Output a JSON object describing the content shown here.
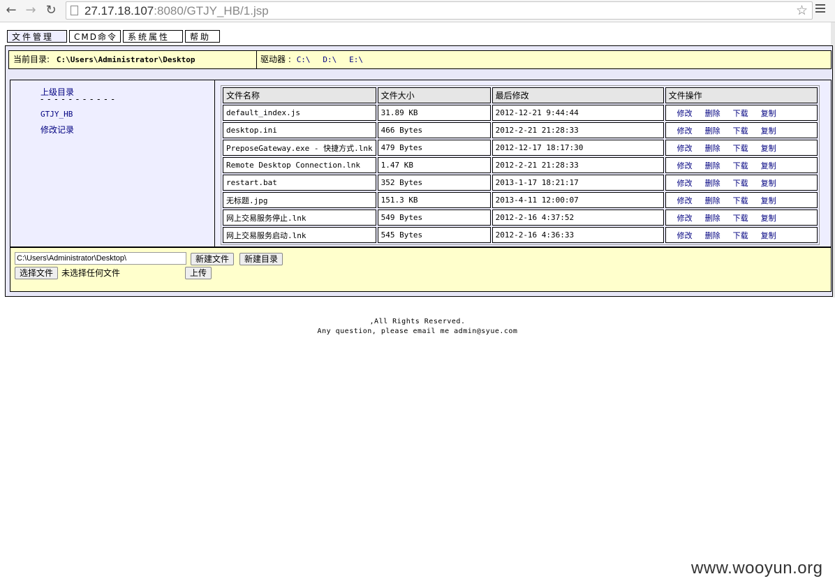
{
  "browser": {
    "url_host": "27.17.18.107",
    "url_rest": ":8080/GTJY_HB/1.jsp"
  },
  "tabs": [
    "文件管理",
    "CMD命令",
    "系统属性",
    "帮助"
  ],
  "dirbar": {
    "current_label": "当前目录:",
    "current_path": "C:\\Users\\Administrator\\Desktop",
    "drives_label": "驱动器 :",
    "drives": [
      "C:\\",
      "D:\\",
      "E:\\"
    ]
  },
  "sidebar": {
    "parent_label": "上级目录",
    "dashes": "- - - - - - - - - - -",
    "items": [
      "GTJY_HB",
      "修改记录"
    ]
  },
  "table": {
    "headers": [
      "文件名称",
      "文件大小",
      "最后修改",
      "文件操作"
    ],
    "ops": [
      "修改",
      "删除",
      "下载",
      "复制"
    ],
    "rows": [
      {
        "name": "default_index.js",
        "size": "31.89 KB",
        "modified": "2012-12-21 9:44:44"
      },
      {
        "name": "desktop.ini",
        "size": "466 Bytes",
        "modified": "2012-2-21 21:28:33"
      },
      {
        "name": "PreposeGateway.exe - 快捷方式.lnk",
        "size": "479 Bytes",
        "modified": "2012-12-17 18:17:30"
      },
      {
        "name": "Remote Desktop Connection.lnk",
        "size": "1.47 KB",
        "modified": "2012-2-21 21:28:33"
      },
      {
        "name": "restart.bat",
        "size": "352 Bytes",
        "modified": "2013-1-17 18:21:17"
      },
      {
        "name": "无标题.jpg",
        "size": "151.3 KB",
        "modified": "2013-4-11 12:00:07"
      },
      {
        "name": "网上交易服务停止.lnk",
        "size": "549 Bytes",
        "modified": "2012-2-16 4:37:52"
      },
      {
        "name": "网上交易服务启动.lnk",
        "size": "545 Bytes",
        "modified": "2012-2-16 4:36:33"
      }
    ]
  },
  "bottom": {
    "path_value": "C:\\Users\\Administrator\\Desktop\\",
    "new_file": "新建文件",
    "new_dir": "新建目录",
    "choose_file": "选择文件",
    "no_file": "未选择任何文件",
    "upload": "上传"
  },
  "footer": {
    "line1": ",All Rights Reserved.",
    "line2": "Any question, please email me admin@syue.com"
  },
  "watermark": "www.wooyun.org"
}
